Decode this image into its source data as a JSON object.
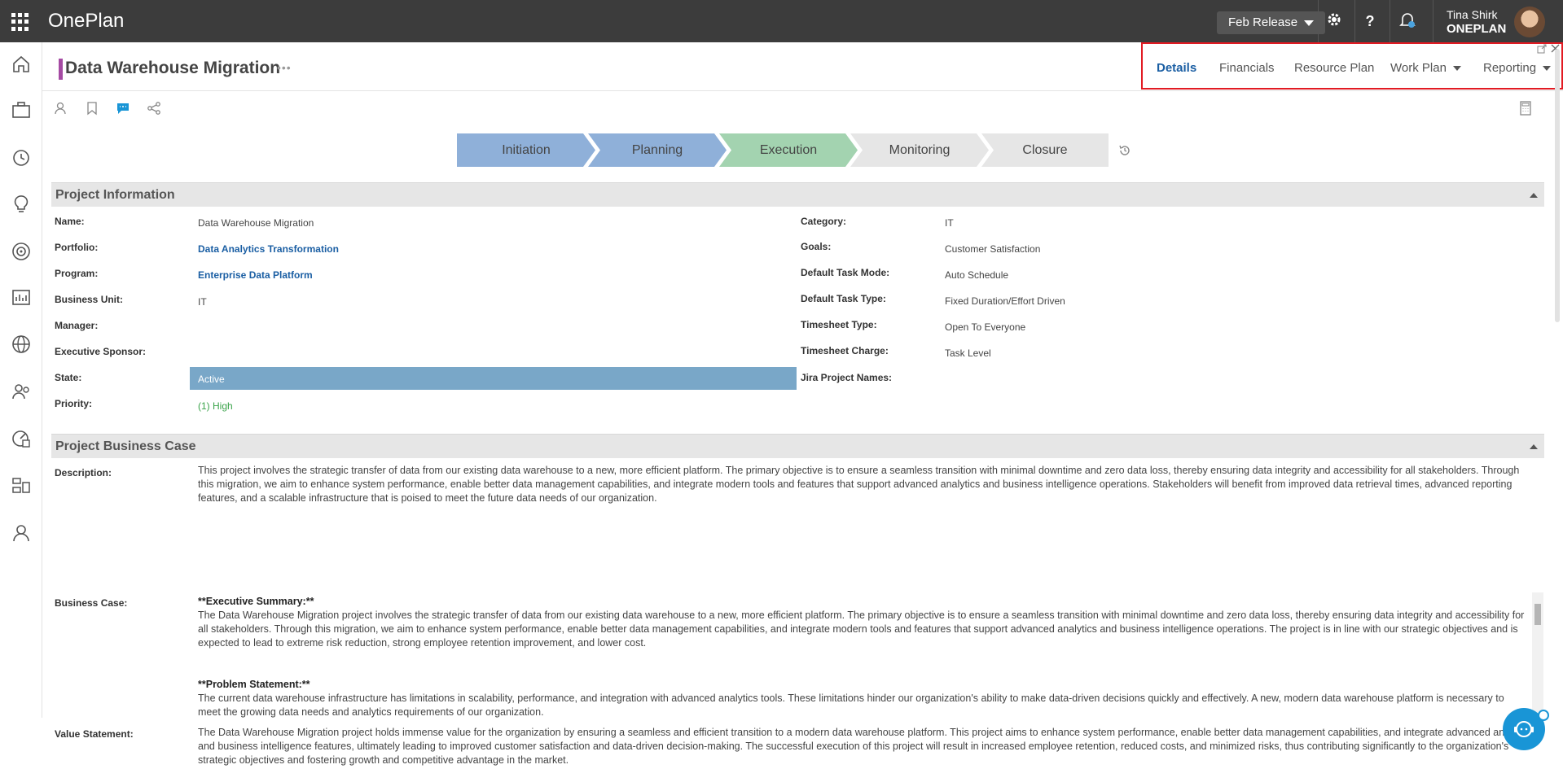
{
  "app": {
    "name": "OnePlan"
  },
  "topbar": {
    "release_label": "Feb Release",
    "user_name": "Tina Shirk",
    "user_org": "ONEPLAN",
    "icons": [
      "settings-icon",
      "help-icon",
      "notifications-icon"
    ],
    "help_glyph": "?"
  },
  "rail": {
    "icons": [
      "home-icon",
      "portfolio-icon",
      "timesheet-icon",
      "ideas-icon",
      "goals-icon",
      "reports-icon",
      "globe-icon",
      "resources-icon",
      "dashboard-icon",
      "org-icon",
      "user-icon",
      "compass-icon"
    ]
  },
  "header": {
    "title": "Data Warehouse Migration",
    "dots": "•••",
    "tabs": [
      {
        "label": "Details",
        "active": true
      },
      {
        "label": "Financials"
      },
      {
        "label": "Resource Plan"
      },
      {
        "label": "Work Plan"
      },
      {
        "label": "Reporting"
      }
    ]
  },
  "stages": [
    {
      "label": "Initiation",
      "color": "#8fb0d9"
    },
    {
      "label": "Planning",
      "color": "#8fb0d9"
    },
    {
      "label": "Execution",
      "color": "#a3d3b0"
    },
    {
      "label": "Monitoring",
      "color": "#e6e6e6"
    },
    {
      "label": "Closure",
      "color": "#e6e6e6"
    }
  ],
  "project_info": {
    "heading": "Project Information",
    "left": [
      {
        "label": "Name:",
        "value": "Data Warehouse Migration"
      },
      {
        "label": "Portfolio:",
        "value": "Data Analytics Transformation"
      },
      {
        "label": "Program:",
        "value": "Enterprise Data Platform"
      },
      {
        "label": "Business Unit:",
        "value": "IT"
      },
      {
        "label": "Manager:",
        "value": ""
      },
      {
        "label": "Executive Sponsor:",
        "value": ""
      },
      {
        "label": "State:",
        "value": "Active"
      },
      {
        "label": "Priority:",
        "value": "(1) High"
      }
    ],
    "right": [
      {
        "label": "Category:",
        "value": "IT"
      },
      {
        "label": "Goals:",
        "value": "Customer Satisfaction"
      },
      {
        "label": "Default Task Mode:",
        "value": "Auto Schedule"
      },
      {
        "label": "Default Task Type:",
        "value": "Fixed Duration/Effort Driven"
      },
      {
        "label": "Timesheet Type:",
        "value": "Open To Everyone"
      },
      {
        "label": "Timesheet Charge:",
        "value": "Task Level"
      },
      {
        "label": "Jira Project Names:",
        "value": ""
      }
    ]
  },
  "business_case": {
    "heading": "Project Business Case",
    "description_label": "Description:",
    "description": "This project involves the strategic transfer of data from our existing data warehouse to a new, more efficient platform. The primary objective is to ensure a seamless transition with minimal downtime and zero data loss, thereby ensuring data integrity and accessibility for all stakeholders. Through this migration, we aim to enhance system performance, enable better data management capabilities, and integrate modern tools and features that support advanced analytics and business intelligence operations. Stakeholders will benefit from improved data retrieval times, advanced reporting features, and a scalable infrastructure that is poised to meet the future data needs of our organization.",
    "business_case_label": "Business Case:",
    "exec_summary_heading": "**Executive Summary:**",
    "exec_summary": "The Data Warehouse Migration project involves the strategic transfer of data from our existing data warehouse to a new, more efficient platform. The primary objective is to ensure a seamless transition with minimal downtime and zero data loss, thereby ensuring data integrity and accessibility for all stakeholders. Through this migration, we aim to enhance system performance, enable better data management capabilities, and integrate modern tools and features that support advanced analytics and business intelligence operations. The project is in line with our strategic objectives and is expected to lead to extreme risk reduction, strong employee retention improvement, and lower cost.",
    "problem_heading": "**Problem Statement:**",
    "problem": "The current data warehouse infrastructure has limitations in scalability, performance, and integration with advanced analytics tools. These limitations hinder our organization's ability to make data-driven decisions quickly and effectively. A new, modern data warehouse platform is necessary to meet the growing data needs and analytics requirements of our organization.",
    "value_label": "Value Statement:",
    "value": "The Data Warehouse Migration project holds immense value for the organization by ensuring a seamless and efficient transition to a modern data warehouse platform. This project aims to enhance system performance, enable better data management capabilities, and integrate advanced analytics and business intelligence features, ultimately leading to improved customer satisfaction and data-driven decision-making. The successful execution of this project will result in increased employee retention, reduced costs, and minimized risks, thus contributing significantly to the organization's strategic objectives and fostering growth and competitive advantage in the market."
  },
  "colors": {
    "accent": "#1a5ea3",
    "title_bar": "#a54aa3",
    "state": "#79a7c8",
    "highlight_box": "#e21b23"
  }
}
